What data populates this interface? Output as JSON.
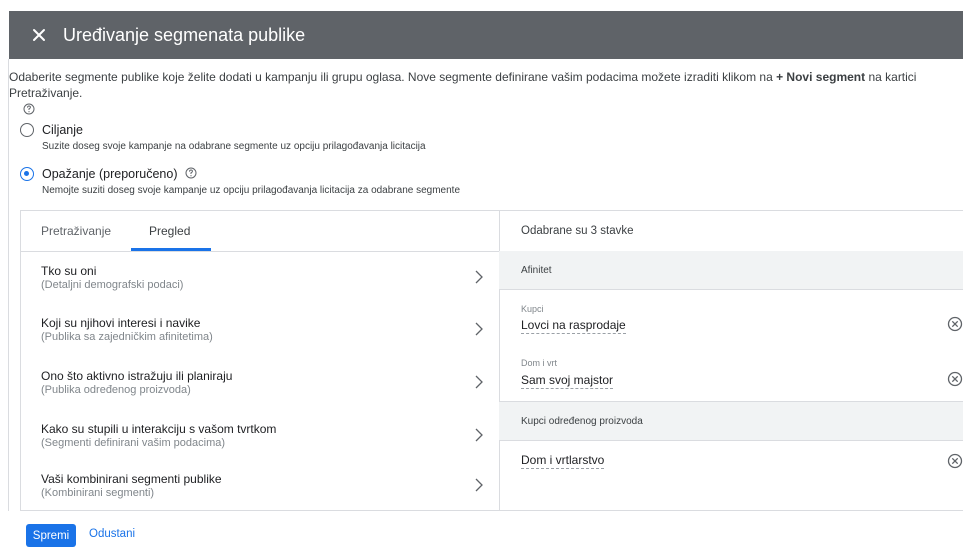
{
  "dialog": {
    "title": "Uređivanje segmenata publike"
  },
  "description": {
    "text_before": "Odaberite segmente publike koje želite dodati u kampanju ili grupu oglasa. Nove segmente definirane vašim podacima možete izraditi klikom na ",
    "bold": "+ Novi segment",
    "text_after": " na kartici Pretraživanje."
  },
  "targeting": {
    "options": [
      {
        "label": "Ciljanje",
        "sub": "Suzite doseg svoje kampanje na odabrane segmente uz opciju prilagođavanja licitacija",
        "checked": false
      },
      {
        "label": "Opažanje (preporučeno)",
        "sub": "Nemojte suziti doseg svoje kampanje uz opciju prilagođavanja licitacija za odabrane segmente",
        "checked": true
      }
    ]
  },
  "tabs": [
    {
      "label": "Pretraživanje",
      "active": false
    },
    {
      "label": "Pregled",
      "active": true
    }
  ],
  "categories": [
    {
      "title": "Tko su oni",
      "sub": "(Detaljni demografski podaci)"
    },
    {
      "title": "Koji su njihovi interesi i navike",
      "sub": "(Publika sa zajedničkim afinitetima)"
    },
    {
      "title": "Ono što aktivno istražuju ili planiraju",
      "sub": "(Publika određenog proizvoda)"
    },
    {
      "title": "Kako su stupili u interakciju s vašom tvrtkom",
      "sub": "(Segmenti definirani vašim podacima)"
    },
    {
      "title": "Vaši kombinirani segmenti publike",
      "sub": "(Kombinirani segmenti)"
    }
  ],
  "selected": {
    "header": "Odabrane su 3 stavke",
    "groups": [
      {
        "name": "Afinitet",
        "items": [
          {
            "category": "Kupci",
            "name": "Lovci na rasprodaje"
          },
          {
            "category": "Dom i vrt",
            "name": "Sam svoj majstor"
          }
        ]
      },
      {
        "name": "Kupci određenog proizvoda",
        "items": [
          {
            "category": "",
            "name": "Dom i vrtlarstvo"
          }
        ]
      }
    ]
  },
  "footer": {
    "save_label": "Spremi",
    "cancel_label": "Odustani"
  },
  "colors": {
    "header_bg": "#5f6368",
    "accent": "#1a73e8",
    "group_bg": "#f1f3f4"
  }
}
